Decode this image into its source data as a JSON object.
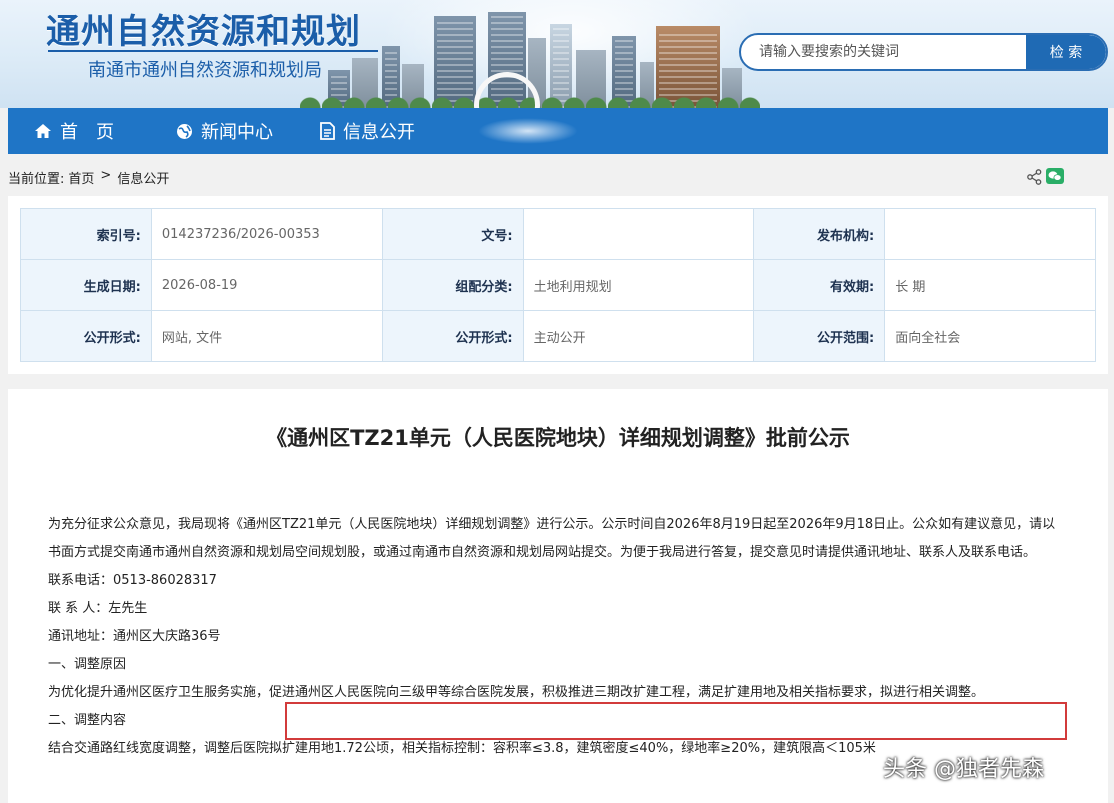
{
  "header": {
    "site_title": "通州自然资源和规划",
    "site_subtitle": "南通市通州自然资源和规划局",
    "search_placeholder": "请输入要搜索的关键词",
    "search_button": "检 索"
  },
  "nav": {
    "items": [
      {
        "label": "首　页",
        "icon": "home-icon"
      },
      {
        "label": "新闻中心",
        "icon": "globe-icon"
      },
      {
        "label": "信息公开",
        "icon": "document-icon"
      }
    ]
  },
  "breadcrumb": {
    "prefix": "当前位置:",
    "home": "首页",
    "separator": ">",
    "current": "信息公开"
  },
  "meta": {
    "rows": [
      [
        {
          "label": "索引号:",
          "value": "014237236/2026-00353"
        },
        {
          "label": "文号:",
          "value": ""
        },
        {
          "label": "发布机构:",
          "value": ""
        }
      ],
      [
        {
          "label": "生成日期:",
          "value": "2026-08-19"
        },
        {
          "label": "组配分类:",
          "value": "土地利用规划"
        },
        {
          "label": "有效期:",
          "value": "长 期"
        }
      ],
      [
        {
          "label": "公开形式:",
          "value": "网站, 文件"
        },
        {
          "label": "公开形式:",
          "value": "主动公开"
        },
        {
          "label": "公开范围:",
          "value": "面向全社会"
        }
      ]
    ]
  },
  "article": {
    "title": "《通州区TZ21单元（人民医院地块）详细规划调整》批前公示",
    "paragraphs": [
      "为充分征求公众意见，我局现将《通州区TZ21单元（人民医院地块）详细规划调整》进行公示。公示时间自2026年8月19日起至2026年9月18日止。公众如有建议意见，请以书面方式提交南通市通州自然资源和规划局空间规划股，或通过南通市自然资源和规划局网站提交。为便于我局进行答复，提交意见时请提供通讯地址、联系人及联系电话。",
      "联系电话：0513-86028317",
      "联 系 人：左先生",
      "通讯地址：通州区大庆路36号",
      "一、调整原因",
      "为优化提升通州区医疗卫生服务实施，促进通州区人民医院向三级甲等综合医院发展，积极推进三期改扩建工程，满足扩建用地及相关指标要求，拟进行相关调整。",
      "二、调整内容",
      "结合交通路红线宽度调整，调整后医院拟扩建用地1.72公顷，相关指标控制：容积率≤3.8，建筑密度≤40%，绿地率≥20%，建筑限高＜105米"
    ]
  },
  "watermark": "头条 @独者先森",
  "colors": {
    "brand": "#1f75c6",
    "highlight": "#d23b3b",
    "wechat": "#2aae67"
  }
}
